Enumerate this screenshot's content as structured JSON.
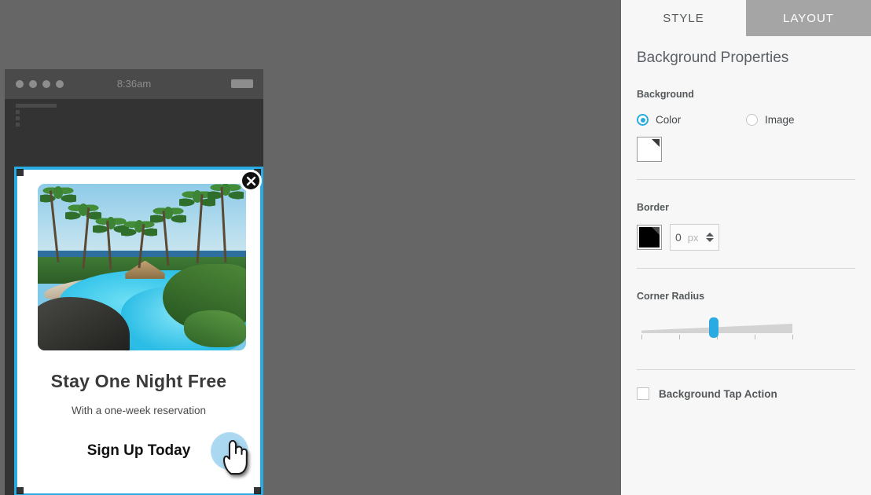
{
  "canvas": {
    "background_color": "#666666",
    "device": {
      "status_bar": {
        "time": "8:36am",
        "signal_dots": 4,
        "battery_icon": "battery-icon"
      },
      "popup": {
        "selected": true,
        "selection_color": "#29abe2",
        "close_icon": "close-icon",
        "image_alt": "tropical-resort-pool",
        "title": "Stay One Night Free",
        "subtitle": "With a one-week reservation",
        "cta": "Sign Up Today",
        "tap_indicator_icon": "hand-cursor-icon"
      }
    }
  },
  "panel": {
    "tabs": [
      {
        "label": "STYLE",
        "active": true
      },
      {
        "label": "LAYOUT",
        "active": false
      }
    ],
    "title": "Background Properties",
    "background": {
      "label": "Background",
      "options": [
        {
          "label": "Color",
          "selected": true
        },
        {
          "label": "Image",
          "selected": false
        }
      ],
      "swatch_color": "#ffffff"
    },
    "border": {
      "label": "Border",
      "swatch_color": "#000000",
      "width_value": "0",
      "width_unit": "px",
      "spinner_icon": "spinner-updown-icon"
    },
    "corner_radius": {
      "label": "Corner Radius",
      "value_percent": 48,
      "thumb_color": "#29abe2",
      "tick_count": 5
    },
    "background_tap_action": {
      "label": "Background Tap Action",
      "checked": false
    }
  }
}
